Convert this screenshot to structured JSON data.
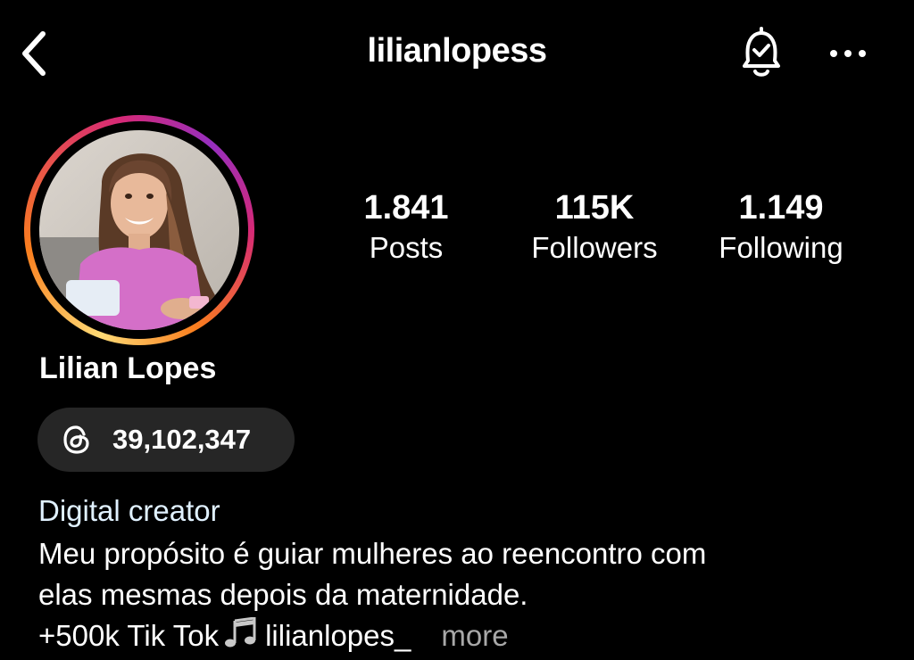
{
  "header": {
    "username": "lilianlopess",
    "back_icon": "chevron-left-icon",
    "bell_icon": "bell-check-icon",
    "more_icon": "ellipsis-icon"
  },
  "stats": {
    "posts": {
      "value": "1.841",
      "label": "Posts"
    },
    "followers": {
      "value": "115K",
      "label": "Followers"
    },
    "following": {
      "value": "1.149",
      "label": "Following"
    }
  },
  "profile": {
    "display_name": "Lilian Lopes",
    "threads_count": "39,102,347",
    "category": "Digital creator",
    "bio_line1": "Meu propósito é guiar mulheres ao reencontro com",
    "bio_line2": "elas mesmas depois da maternidade.",
    "bio_line3_prefix": "+500k Tik Tok",
    "bio_line3_suffix": "lilianlopes_",
    "more_label": "more"
  },
  "colors": {
    "background": "#000000",
    "pill": "#262626",
    "category_text": "#e0f1ff",
    "muted": "#a8a8a8"
  }
}
